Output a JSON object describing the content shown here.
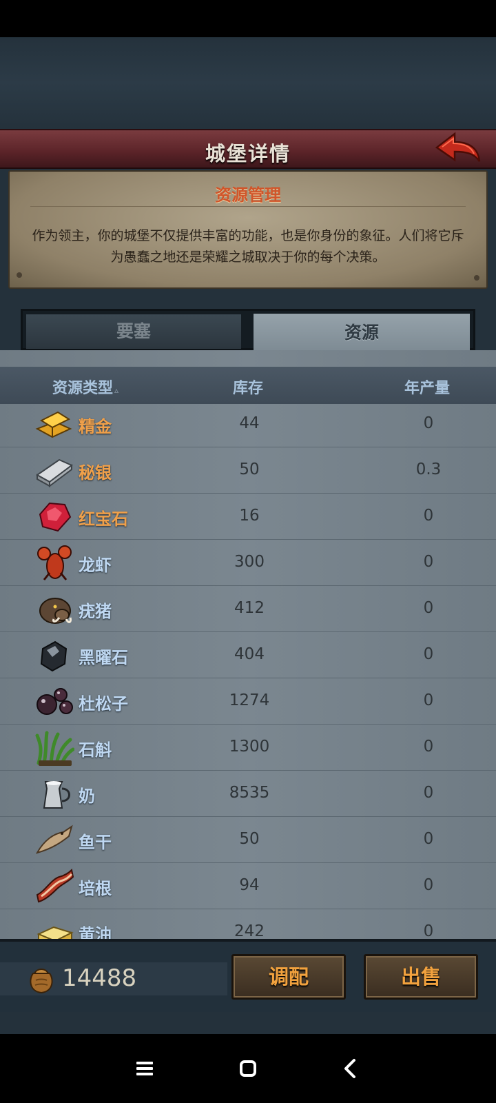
{
  "title": "城堡详情",
  "info": {
    "heading": "资源管理",
    "description": "作为领主，你的城堡不仅提供丰富的功能，也是你身份的象征。人们将它斥为愚蠢之地还是荣耀之城取决于你的每个决策。"
  },
  "tabs": [
    {
      "label": "要塞",
      "active": false
    },
    {
      "label": "资源",
      "active": true
    }
  ],
  "table": {
    "columns": {
      "type": "资源类型",
      "stock": "库存",
      "yearly": "年产量"
    },
    "rows": [
      {
        "icon": "gold-bar-icon",
        "name": "精金",
        "stock": "44",
        "yearly": "0",
        "rare": true
      },
      {
        "icon": "silver-ingot-icon",
        "name": "秘银",
        "stock": "50",
        "yearly": "0.3",
        "rare": true
      },
      {
        "icon": "ruby-icon",
        "name": "红宝石",
        "stock": "16",
        "yearly": "0",
        "rare": true
      },
      {
        "icon": "lobster-icon",
        "name": "龙虾",
        "stock": "300",
        "yearly": "0",
        "rare": false
      },
      {
        "icon": "boar-icon",
        "name": "疣猪",
        "stock": "412",
        "yearly": "0",
        "rare": false
      },
      {
        "icon": "obsidian-icon",
        "name": "黑曜石",
        "stock": "404",
        "yearly": "0",
        "rare": false
      },
      {
        "icon": "juniper-berries-icon",
        "name": "杜松子",
        "stock": "1274",
        "yearly": "0",
        "rare": false
      },
      {
        "icon": "dendrobium-icon",
        "name": "石斛",
        "stock": "1300",
        "yearly": "0",
        "rare": false
      },
      {
        "icon": "milk-jug-icon",
        "name": "奶",
        "stock": "8535",
        "yearly": "0",
        "rare": false
      },
      {
        "icon": "dried-fish-icon",
        "name": "鱼干",
        "stock": "50",
        "yearly": "0",
        "rare": false
      },
      {
        "icon": "bacon-icon",
        "name": "培根",
        "stock": "94",
        "yearly": "0",
        "rare": false
      },
      {
        "icon": "butter-icon",
        "name": "黄油",
        "stock": "242",
        "yearly": "0",
        "rare": false
      }
    ]
  },
  "footer": {
    "gold": "14488",
    "allocate_label": "调配",
    "sell_label": "出售"
  },
  "colors": {
    "rare_name": "#f0a04a",
    "common_name": "#bfd8f2",
    "title_banner": "#5a2328",
    "button_text": "#f2a23e"
  }
}
